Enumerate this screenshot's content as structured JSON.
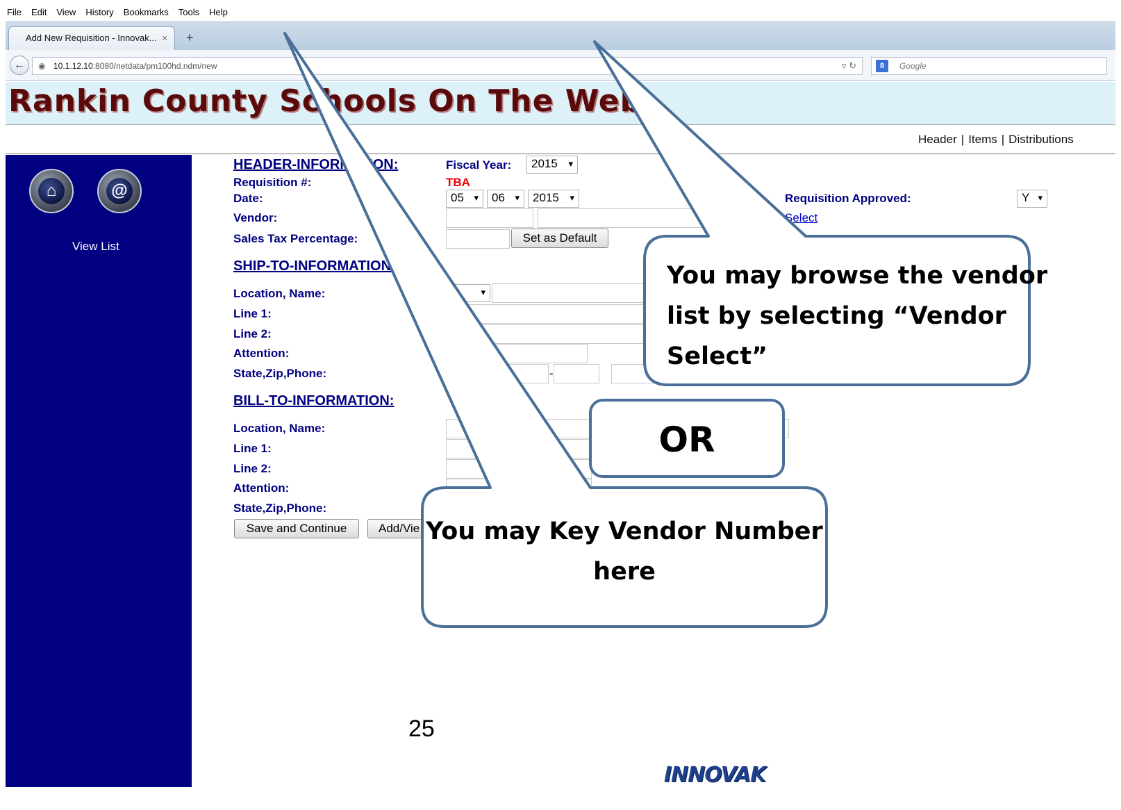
{
  "browser": {
    "menu": [
      "File",
      "Edit",
      "View",
      "History",
      "Bookmarks",
      "Tools",
      "Help"
    ],
    "tab_title": "Add New Requisition - Innovak...",
    "tab_close": "×",
    "new_tab": "+",
    "url_host": "10.1.12.10",
    "url_path": ":8080/netdata/pm100hd.ndm/new",
    "search_placeholder": "Google"
  },
  "site": {
    "title": "Rankin County Schools On The Web",
    "nav": [
      "Header",
      "Items",
      "Distributions"
    ]
  },
  "sidebar": {
    "view_list": "View List"
  },
  "form": {
    "header_section": "HEADER-INFORMATION:",
    "fiscal_year_label": "Fiscal Year:",
    "fiscal_year_value": "2015",
    "requisition_label": "Requisition #:",
    "requisition_value": "TBA",
    "date_label": "Date:",
    "date_month": "05",
    "date_day": "06",
    "date_year": "2015",
    "approved_label": "Requisition Approved:",
    "approved_value": "Y",
    "vendor_label": "Vendor:",
    "vendor_select_link": "Select",
    "sales_tax_label": "Sales Tax Percentage:",
    "set_default_button": "Set as Default",
    "ship_section": "SHIP-TO-INFORMATION:",
    "bill_section": "BILL-TO-INFORMATION:",
    "location_name_label": "Location, Name:",
    "line1_label": "Line 1:",
    "line2_label": "Line 2:",
    "attention_label": "Attention:",
    "state_zip_phone_label": "State,Zip,Phone:",
    "zip_dash": "-",
    "save_continue_button": "Save and Continue",
    "add_view_button": "Add/Vie"
  },
  "callouts": {
    "browse": "You may browse the vendor list by selecting “Vendor Select”",
    "browse_lines": [
      "You may browse the vendor",
      "list by selecting “Vendor",
      "Select”"
    ],
    "or": "OR",
    "key_lines": [
      "You may Key Vendor Number",
      "here"
    ]
  },
  "footer": {
    "page_number": "25",
    "logo_text": "INNOVAK"
  },
  "colors": {
    "sidebar": "#000080",
    "label": "#000080",
    "callout_stroke": "#4a6f98"
  }
}
